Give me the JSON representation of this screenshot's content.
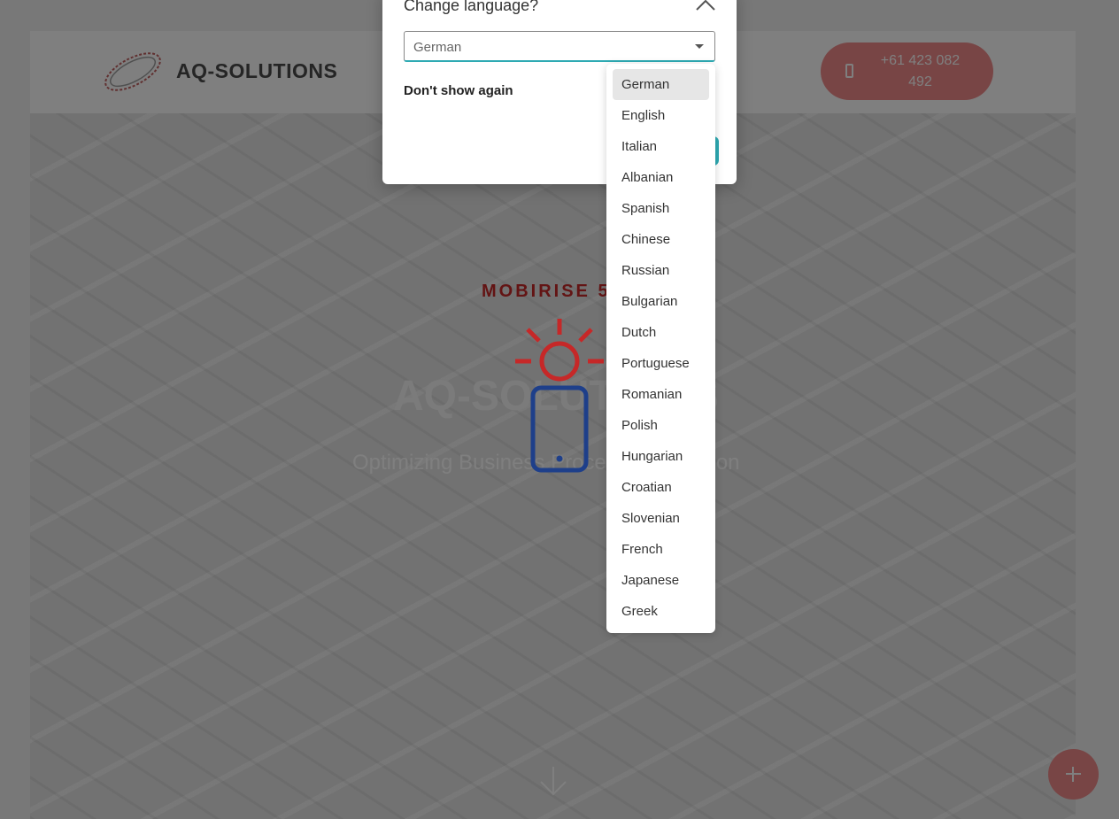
{
  "navbar": {
    "brand": "AQ-SOLUTIONS",
    "phone_line1": "+61 423 082",
    "phone_line2": "492"
  },
  "hero": {
    "eyebrow": "MOBIRISE 5.",
    "title": "AQ-SOLUTIONS",
    "subtitle": "Optimizing Business Process Automation"
  },
  "modal": {
    "title": "Change language?",
    "selected_language": "German",
    "dont_show_label": "Don't show again"
  },
  "dropdown": {
    "options": [
      "German",
      "English",
      "Italian",
      "Albanian",
      "Spanish",
      "Chinese",
      "Russian",
      "Bulgarian",
      "Dutch",
      "Portuguese",
      "Romanian",
      "Polish",
      "Hungarian",
      "Croatian",
      "Slovenian",
      "French",
      "Japanese",
      "Greek"
    ],
    "selected_index": 0
  },
  "colors": {
    "accent": "#2eaab3",
    "brand_red": "#c62828",
    "button_pink": "#f08a8a"
  }
}
